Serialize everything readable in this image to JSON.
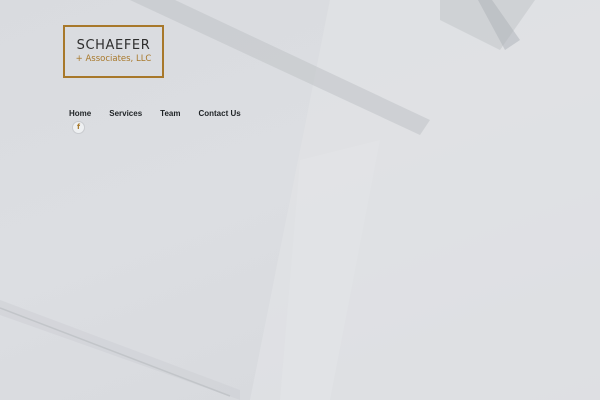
{
  "logo": {
    "name": "SCHAEFER",
    "subtitle": "+ Associates, LLC"
  },
  "nav": {
    "items": [
      {
        "label": "Home"
      },
      {
        "label": "Services"
      },
      {
        "label": "Team"
      },
      {
        "label": "Contact Us"
      }
    ]
  },
  "social": {
    "facebook_glyph": "f",
    "icon": "facebook-icon"
  },
  "colors": {
    "accent": "#a8782a",
    "background": "#d8dadd",
    "nav_text": "#1f2326"
  }
}
